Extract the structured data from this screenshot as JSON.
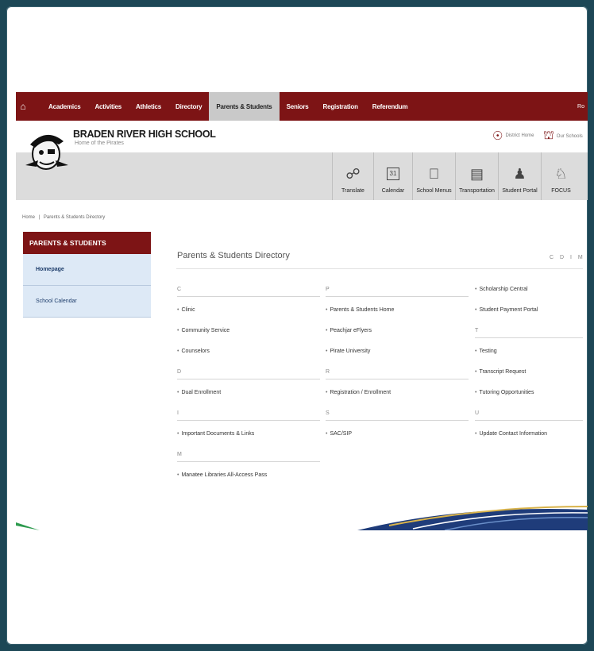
{
  "nav": {
    "items": [
      "Academics",
      "Activities",
      "Athletics",
      "Directory",
      "Parents & Students",
      "Seniors",
      "Registration",
      "Referendum"
    ],
    "active_index": 4,
    "right_text": "Ro"
  },
  "header": {
    "school_name": "BRADEN RIVER HIGH SCHOOL",
    "tagline": "Home of the Pirates",
    "district_home": "District Home",
    "our_schools": "Our Schools"
  },
  "quick_links": [
    {
      "label": "Translate",
      "icon": "translate-icon"
    },
    {
      "label": "Calendar",
      "icon": "calendar-icon",
      "glyph": "31"
    },
    {
      "label": "School Menus",
      "icon": "apple-icon"
    },
    {
      "label": "Transportation",
      "icon": "bus-icon"
    },
    {
      "label": "Student Portal",
      "icon": "students-icon"
    },
    {
      "label": "FOCUS",
      "icon": "graduate-icon"
    }
  ],
  "breadcrumb": {
    "home": "Home",
    "separator": "|",
    "current": "Parents & Students Directory"
  },
  "sidebar": {
    "title": "PARENTS & STUDENTS",
    "items": [
      "Homepage",
      "School Calendar"
    ]
  },
  "content": {
    "title": "Parents & Students Directory",
    "az": "C D I M",
    "columns": [
      [
        {
          "type": "letter",
          "text": "C"
        },
        {
          "type": "link",
          "text": "Clinic"
        },
        {
          "type": "link",
          "text": "Community Service"
        },
        {
          "type": "link",
          "text": "Counselors"
        },
        {
          "type": "letter",
          "text": "D"
        },
        {
          "type": "link",
          "text": "Dual Enrollment"
        },
        {
          "type": "letter",
          "text": "I"
        },
        {
          "type": "link",
          "text": "Important Documents & Links"
        },
        {
          "type": "letter",
          "text": "M"
        },
        {
          "type": "link",
          "text": "Manatee Libraries All-Access Pass"
        }
      ],
      [
        {
          "type": "letter",
          "text": "P"
        },
        {
          "type": "link",
          "text": "Parents & Students Home"
        },
        {
          "type": "link",
          "text": "Peachjar eFlyers"
        },
        {
          "type": "link",
          "text": "Pirate University"
        },
        {
          "type": "letter",
          "text": "R"
        },
        {
          "type": "link",
          "text": "Registration / Enrollment"
        },
        {
          "type": "letter",
          "text": "S"
        },
        {
          "type": "link",
          "text": "SAC/SIP"
        }
      ],
      [
        {
          "type": "link",
          "text": "Scholarship Central"
        },
        {
          "type": "link",
          "text": "Student Payment Portal"
        },
        {
          "type": "letter",
          "text": "T"
        },
        {
          "type": "link",
          "text": "Testing"
        },
        {
          "type": "link",
          "text": "Transcript Request"
        },
        {
          "type": "link",
          "text": "Tutoring Opportunities"
        },
        {
          "type": "letter",
          "text": "U"
        },
        {
          "type": "link",
          "text": "Update Contact Information"
        }
      ]
    ]
  },
  "colors": {
    "brand": "#7d1415",
    "sidebar_bg": "#dde9f6",
    "frame_bg": "#1d4756"
  }
}
